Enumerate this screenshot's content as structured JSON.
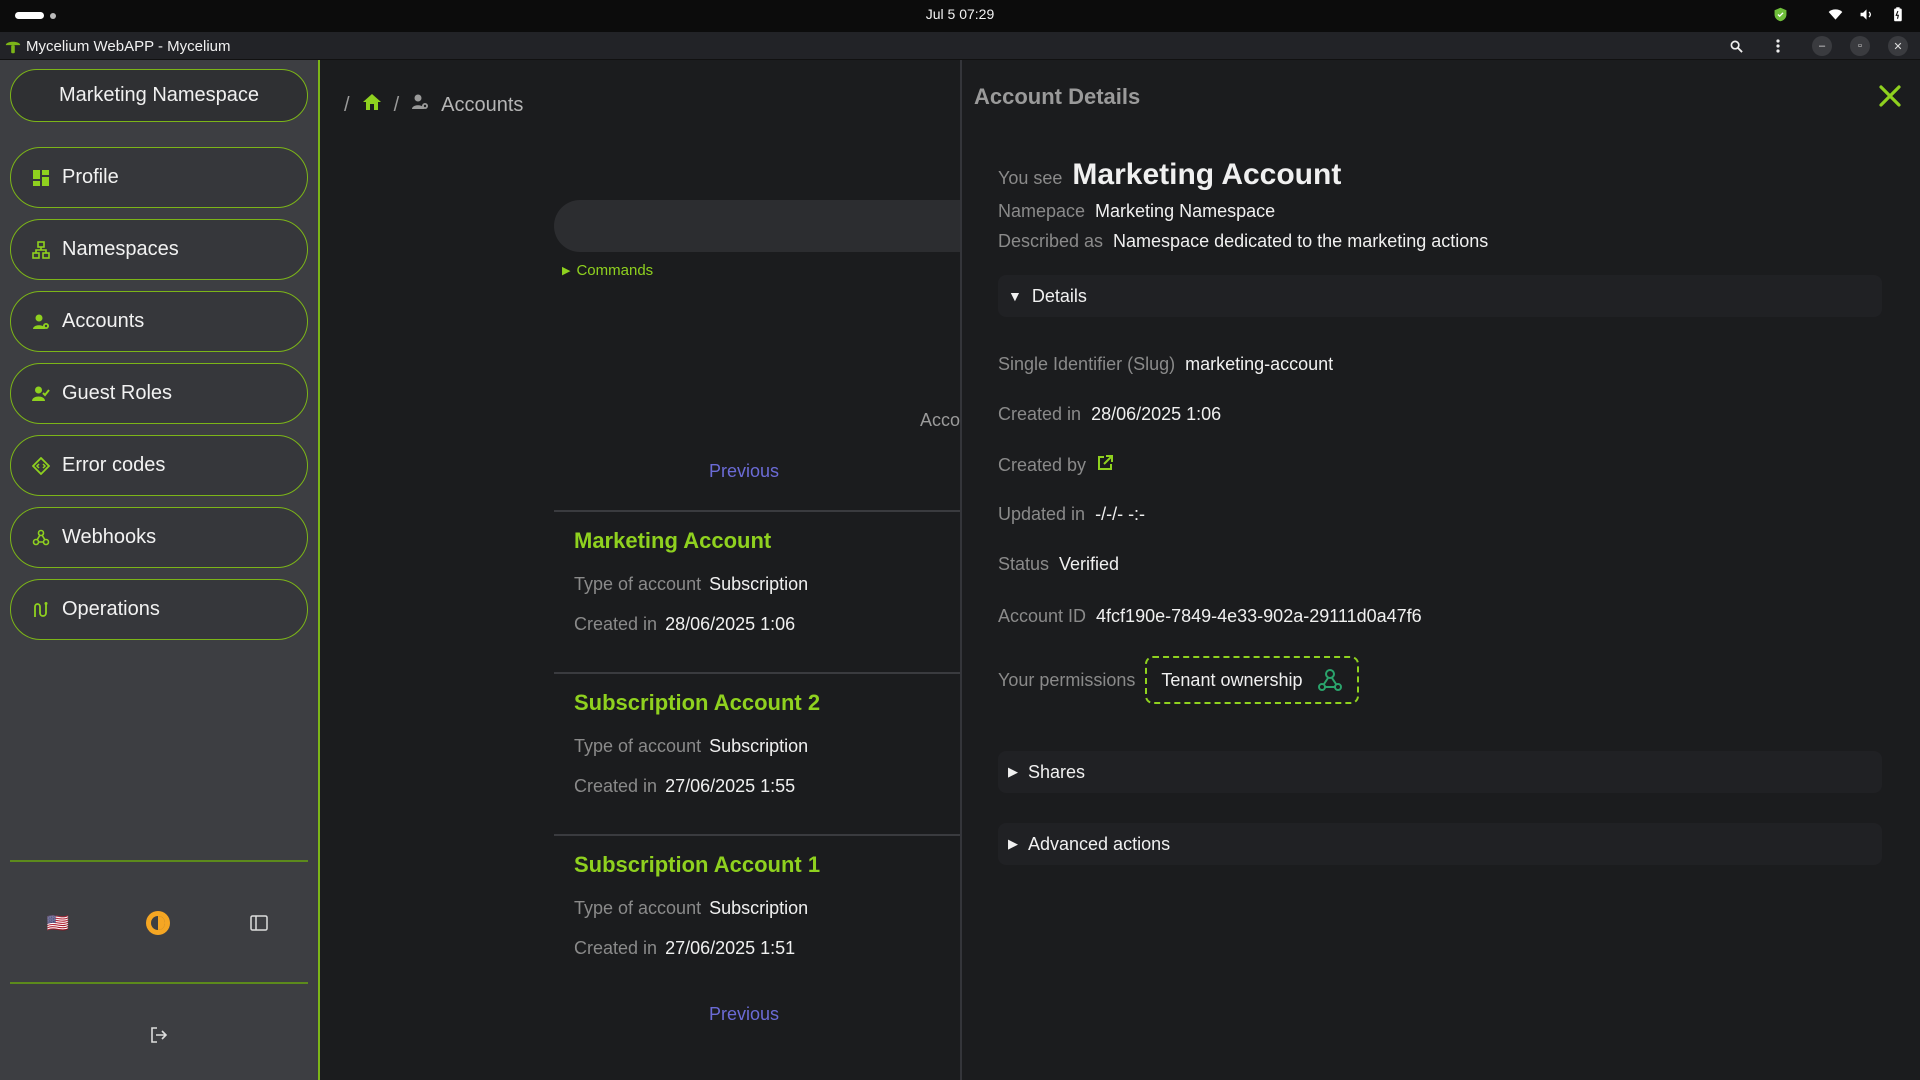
{
  "os": {
    "clock": "Jul 5  07:29"
  },
  "window": {
    "title": "Mycelium WebAPP - Mycelium"
  },
  "colors": {
    "accent": "#8fd11f",
    "link": "#6b6bd6",
    "sidebar_bg": "#3d3e42",
    "bg": "#1b1c1e",
    "footer_icon": "#f5a623"
  },
  "sidebar": {
    "namespace": "Marketing Namespace",
    "items": [
      {
        "label": "Profile",
        "icon": "dashboard-icon"
      },
      {
        "label": "Namespaces",
        "icon": "hierarchy-icon"
      },
      {
        "label": "Accounts",
        "icon": "user-gear-icon"
      },
      {
        "label": "Guest Roles",
        "icon": "user-check-icon"
      },
      {
        "label": "Error codes",
        "icon": "diamond-code-icon"
      },
      {
        "label": "Webhooks",
        "icon": "webhook-icon"
      },
      {
        "label": "Operations",
        "icon": "route-icon"
      }
    ],
    "footer": {
      "language_flag": "🇺🇸"
    }
  },
  "main": {
    "breadcrumb": {
      "sep": "/",
      "current": "Accounts"
    },
    "commands_label": "Commands",
    "partial_hint": "Acco",
    "prev_label": "Previous",
    "accounts": [
      {
        "name": "Marketing Account",
        "type_label": "Type of account",
        "type": "Subscription",
        "created_label": "Created in",
        "created": "28/06/2025 1:06"
      },
      {
        "name": "Subscription Account 2",
        "type_label": "Type of account",
        "type": "Subscription",
        "created_label": "Created in",
        "created": "27/06/2025 1:55"
      },
      {
        "name": "Subscription Account 1",
        "type_label": "Type of account",
        "type": "Subscription",
        "created_label": "Created in",
        "created": "27/06/2025 1:51"
      }
    ]
  },
  "details": {
    "title": "Account Details",
    "you_see_label": "You see",
    "account_name": "Marketing Account",
    "namespace_label": "Namepace",
    "namespace": "Marketing Namespace",
    "described_label": "Described as",
    "description": "Namespace dedicated to the marketing actions",
    "details_section": "Details",
    "slug_label": "Single Identifier (Slug)",
    "slug": "marketing-account",
    "created_label": "Created in",
    "created": "28/06/2025 1:06",
    "created_by_label": "Created by",
    "updated_label": "Updated in",
    "updated": "-/-/- -:-",
    "status_label": "Status",
    "status": "Verified",
    "account_id_label": "Account ID",
    "account_id": "4fcf190e-7849-4e33-902a-29111d0a47f6",
    "permissions_label": "Your permissions",
    "permission": "Tenant ownership",
    "shares_section": "Shares",
    "advanced_section": "Advanced actions"
  }
}
